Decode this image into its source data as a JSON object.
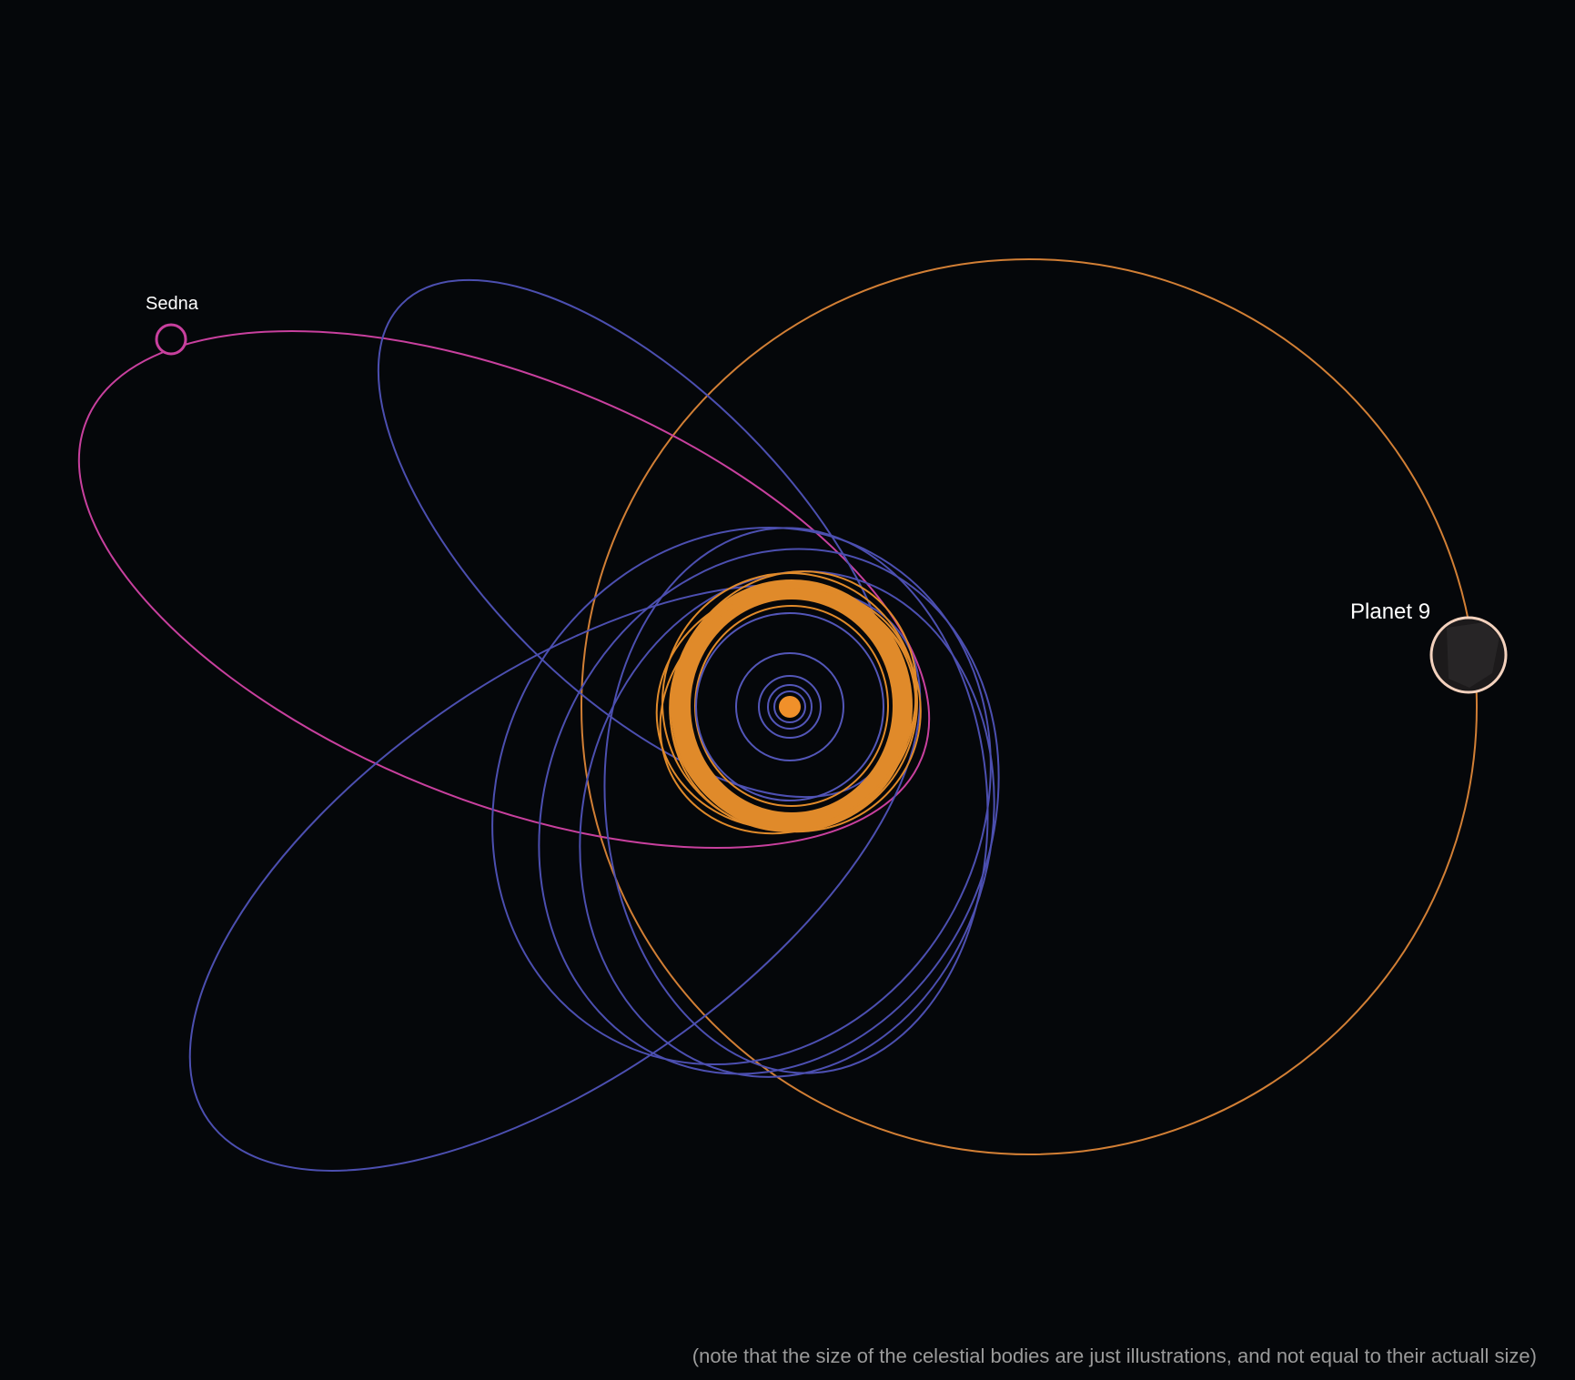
{
  "labels": {
    "sedna": "Sedna",
    "planet9": "Planet 9"
  },
  "note": "(note that the size of the celestial bodies are just illustrations, and not equal to their actuall size)",
  "colors": {
    "background": "#05070a",
    "sun": "#f0902a",
    "inner_planet_orbits": "#5356b8",
    "kuiper_belt": "#e08a2a",
    "etno_orbits": "#4c4fb0",
    "sedna_orbit": "#c8409e",
    "planet9_orbit": "#d27f35",
    "planet9_body": "#1c1a1b",
    "planet9_rim": "#f3d1bd",
    "label_text": "#ffffff",
    "note_text": "#9a9a9a"
  }
}
